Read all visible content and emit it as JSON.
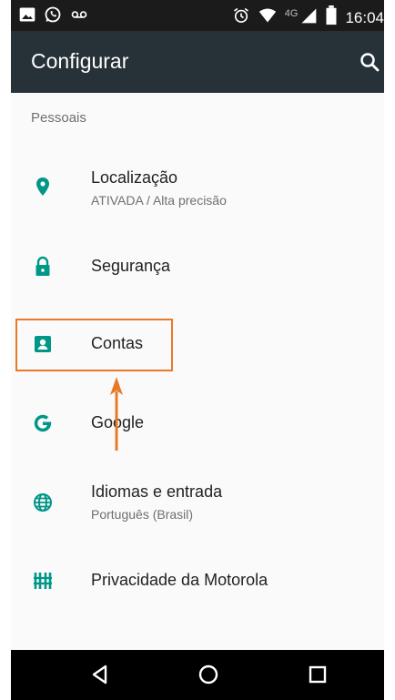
{
  "status_bar": {
    "left_icons": [
      "image-icon",
      "whatsapp-icon",
      "voicemail-icon"
    ],
    "right_icons": [
      "alarm-icon",
      "wifi-icon",
      "signal-icon",
      "battery-icon"
    ],
    "network": "4G",
    "time": "16:04"
  },
  "app_bar": {
    "title": "Configurar",
    "search_icon": "search-icon",
    "background": "#263238"
  },
  "section": {
    "label": "Pessoais"
  },
  "items": [
    {
      "title": "Localização",
      "subtitle": "ATIVADA / Alta precisão",
      "icon": "location-pin-icon"
    },
    {
      "title": "Segurança",
      "icon": "lock-icon"
    },
    {
      "title": "Contas",
      "icon": "account-box-icon",
      "highlighted": true
    },
    {
      "title": "Google",
      "icon": "google-g-icon"
    },
    {
      "title": "Idiomas e entrada",
      "subtitle": "Português (Brasil)",
      "icon": "globe-icon"
    },
    {
      "title": "Privacidade da Motorola",
      "icon": "motorola-privacy-icon"
    }
  ],
  "nav_bar": {
    "buttons": [
      "back-icon",
      "home-icon",
      "recents-icon"
    ]
  },
  "colors": {
    "accent": "#009688",
    "annotation": "#e8792a"
  }
}
